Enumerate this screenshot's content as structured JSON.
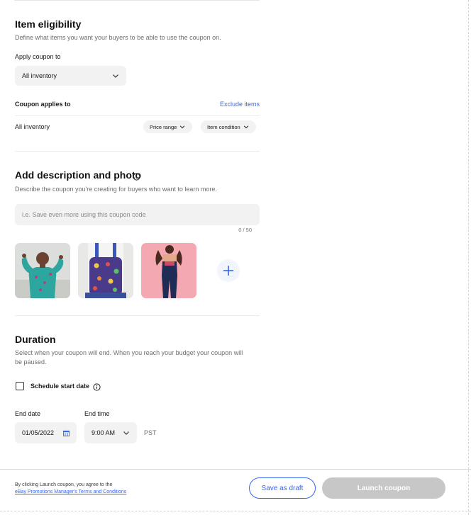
{
  "item_eligibility": {
    "title": "Item eligibility",
    "description": "Define what items you want your buyers to be able to use the coupon on.",
    "apply_label": "Apply coupon to",
    "apply_value": "All inventory",
    "applies_to_heading": "Coupon applies to",
    "exclude_link": "Exclude items",
    "row_label": "All inventory",
    "filters": [
      "Price range",
      "Item condition"
    ]
  },
  "description_photo": {
    "title": "Add description and photo",
    "description": "Describe the coupon you're creating for buyers who want to learn more.",
    "input_placeholder": "i.e. Save even more using this coupon code",
    "input_value": "",
    "counter": "0 / 50"
  },
  "duration": {
    "title": "Duration",
    "description_line1": "Select when your coupon will end. When you reach your budget your coupon will",
    "description_line2": "be paused.",
    "schedule_label": "Schedule start date",
    "schedule_checked": false,
    "end_date_label": "End date",
    "end_date_value": "01/05/2022",
    "end_time_label": "End time",
    "end_time_value": "9:00 AM",
    "timezone": "PST"
  },
  "footer": {
    "agree_text": "By clicking Launch coupon, you agree to the",
    "terms_link": "eBay Promotions Manager's Terms and Conditions",
    "save_draft": "Save as draft",
    "launch": "Launch coupon"
  },
  "colors": {
    "accent": "#3665f3",
    "disabled_button": "#c7c7c7",
    "field_background": "#f2f2f2"
  }
}
